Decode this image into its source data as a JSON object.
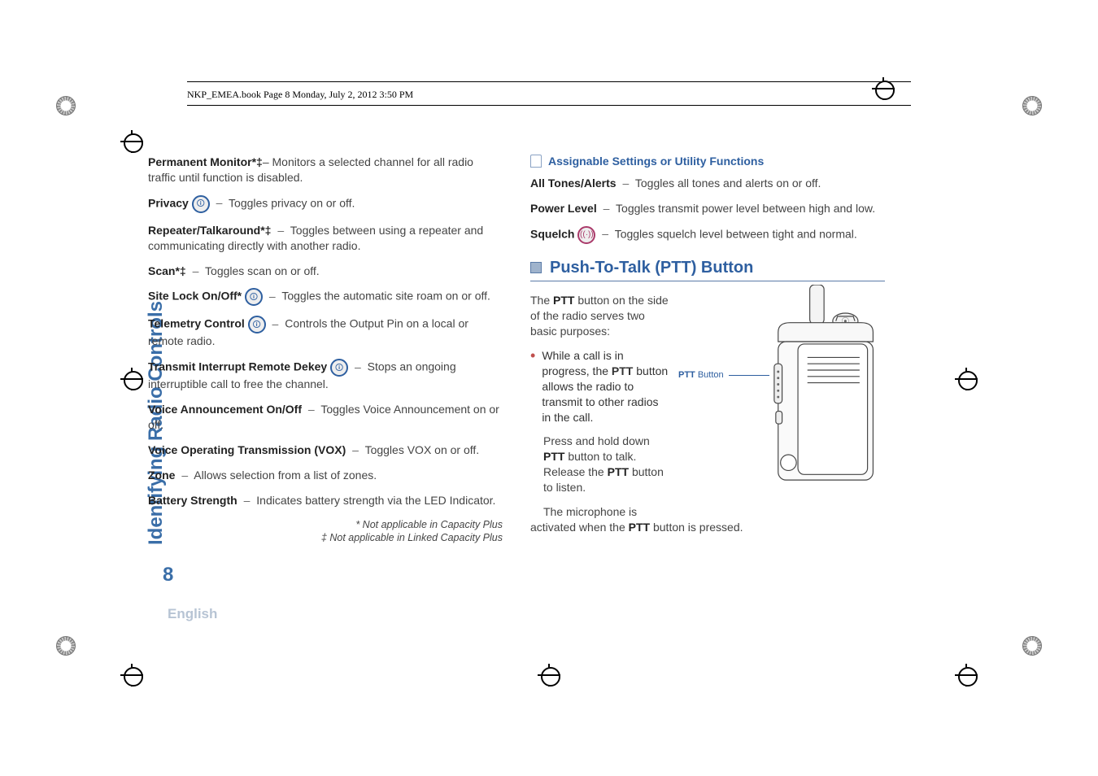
{
  "header": {
    "running": "NKP_EMEA.book  Page 8  Monday, July 2, 2012  3:50 PM"
  },
  "side_label": "Identifying Radio Controls",
  "page_number": "8",
  "language": "English",
  "left": {
    "permanent_monitor": {
      "label": "Permanent Monitor*‡",
      "desc": "Monitors a selected channel for all radio traffic until function is disabled."
    },
    "privacy": {
      "label": "Privacy",
      "desc": "Toggles privacy on or off."
    },
    "repeater": {
      "label": "Repeater/Talkaround*‡",
      "desc": "Toggles between using a repeater and communicating directly with another radio."
    },
    "scan": {
      "label": "Scan*‡",
      "desc": "Toggles scan on or off."
    },
    "site_lock": {
      "label": "Site Lock On/Off*",
      "desc": "Toggles the automatic site roam on or off."
    },
    "telemetry": {
      "label": "Telemetry Control",
      "desc": "Controls the Output Pin on a local or remote radio."
    },
    "tx_interrupt": {
      "label": "Transmit Interrupt Remote Dekey",
      "desc": "Stops an ongoing interruptible call to free the channel."
    },
    "voice_ann": {
      "label": "Voice Announcement On/Off",
      "desc": "Toggles Voice Announcement on or off."
    },
    "vox": {
      "label": "Voice Operating Transmission (VOX)",
      "desc": "Toggles VOX on or off."
    },
    "zone": {
      "label": "Zone",
      "desc": "Allows selection from a list of zones."
    },
    "battery": {
      "label": "Battery Strength",
      "desc": "Indicates battery strength via the LED Indicator."
    },
    "footnote1": "* Not applicable in Capacity Plus",
    "footnote2": "‡ Not applicable in Linked Capacity Plus"
  },
  "right": {
    "settings_heading": "Assignable Settings or Utility Functions",
    "tones": {
      "label": "All Tones/Alerts",
      "desc": "Toggles all tones and alerts on or off."
    },
    "power": {
      "label": "Power Level",
      "desc": "Toggles transmit power level between high and low."
    },
    "squelch": {
      "label": "Squelch",
      "desc": "Toggles squelch level between tight and normal."
    },
    "ptt_heading": "Push-To-Talk (PTT) Button",
    "ptt_intro_1": "The ",
    "ptt_intro_bold": "PTT",
    "ptt_intro_2": " button on the side of the radio serves two basic purposes:",
    "ptt_bullet_1a": "While a call is in progress, the ",
    "ptt_bullet_1b": " button allows the radio to transmit to other radios in the call.",
    "ptt_hold_1": "Press and hold down ",
    "ptt_hold_2": " button to talk. Release the ",
    "ptt_hold_3": " button to listen.",
    "ptt_mic_1": "The microphone is activated when the ",
    "ptt_mic_2": " button is pressed.",
    "ptt_button_label_bold": "PTT",
    "ptt_button_label_rest": " Button"
  }
}
